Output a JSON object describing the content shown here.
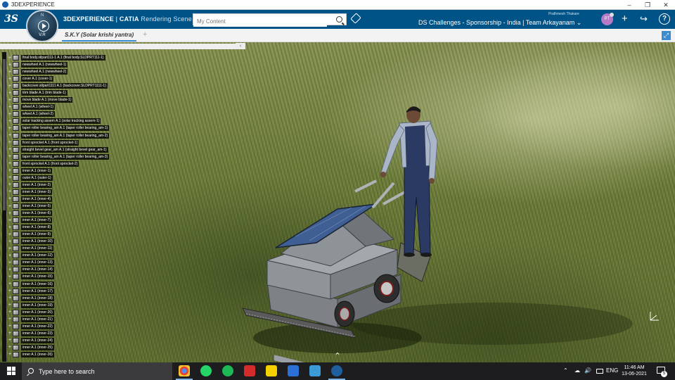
{
  "window": {
    "title": "3DEXPERIENCE",
    "controls": [
      "–",
      "❐",
      "✕"
    ]
  },
  "header": {
    "logo": "3S",
    "compass": {
      "version": "V.R",
      "top_label": "N"
    },
    "brand_main": "3DEXPERIENCE",
    "brand_sep": " | ",
    "brand_product": "CATIA",
    "brand_app": " Rendering Scene...",
    "search_placeholder": "My Content",
    "user_name": "Prathmesh Thakare",
    "space_title": "DS Challenges - Sponsorship - India | Team Arkayanam ⌄",
    "avatar_initials": "PT",
    "icons": [
      "tag-icon",
      "plus-icon",
      "share-icon",
      "help-icon"
    ]
  },
  "tabs": {
    "active_label": "S.K.Y (Solar krishi yantra)",
    "add_label": "+"
  },
  "tree": {
    "collapse_label": "‹",
    "items": [
      "final body.stlpart111-1 A.1 (final body.SLDPRT111-1)",
      "newwheel A.1 (newwheel-1)",
      "newwheel A.1 (newwheel-2)",
      "cover A.1 (cover-1)",
      "backcover.stlpart1111 A.1 (backcover.SLDPRT1111-1)",
      "trim blade A.1 (trim blade-1)",
      "move blade A.1 (move blade-1)",
      "wheel A.1 (wheel-1)",
      "wheel A.1 (wheel-2)",
      "solar tracking assem A.1 (solar tracking assem-1)",
      "taper roller bearing_am A.1 (taper roller bearing_am-1)",
      "taper roller bearing_am A.1 (taper roller bearing_am-2)",
      "front sprocket A.1 (front sprocket-1)",
      "straight bevel gear_am A.1 (straight bevel gear_am-1)",
      "taper roller bearing_am A.1 (taper roller bearing_am-3)",
      "front sprocket A.1 (front sprocket-2)",
      "inner A.1 (inner-1)",
      "outer A.1 (outer-1)",
      "inner A.1 (inner-2)",
      "inner A.1 (inner-3)",
      "inner A.1 (inner-4)",
      "inner A.1 (inner-5)",
      "inner A.1 (inner-6)",
      "inner A.1 (inner-7)",
      "inner A.1 (inner-8)",
      "inner A.1 (inner-9)",
      "inner A.1 (inner-10)",
      "inner A.1 (inner-11)",
      "inner A.1 (inner-12)",
      "inner A.1 (inner-13)",
      "inner A.1 (inner-14)",
      "inner A.1 (inner-15)",
      "inner A.1 (inner-16)",
      "inner A.1 (inner-17)",
      "inner A.1 (inner-18)",
      "inner A.1 (inner-19)",
      "inner A.1 (inner-20)",
      "inner A.1 (inner-21)",
      "inner A.1 (inner-22)",
      "inner A.1 (inner-23)",
      "inner A.1 (inner-24)",
      "inner A.1 (inner-25)",
      "inner A.1 (inner-26)"
    ]
  },
  "viewport": {
    "up_arrow": "⌃"
  },
  "taskbar": {
    "search_placeholder": "Type here to search",
    "apps": [
      "chrome",
      "whatsapp",
      "spotify",
      "news",
      "sticky-notes",
      "edge-dev",
      "photos",
      "3dexperience"
    ],
    "tray_icons": [
      "⌃",
      "☁",
      "🔊",
      "ENG"
    ],
    "time": "11:46 AM",
    "date": "13-06-2021",
    "notification_count": "5"
  },
  "colors": {
    "appbar": "#005386",
    "accent": "#3a8dd1",
    "taskbar": "#1d1d1f"
  }
}
